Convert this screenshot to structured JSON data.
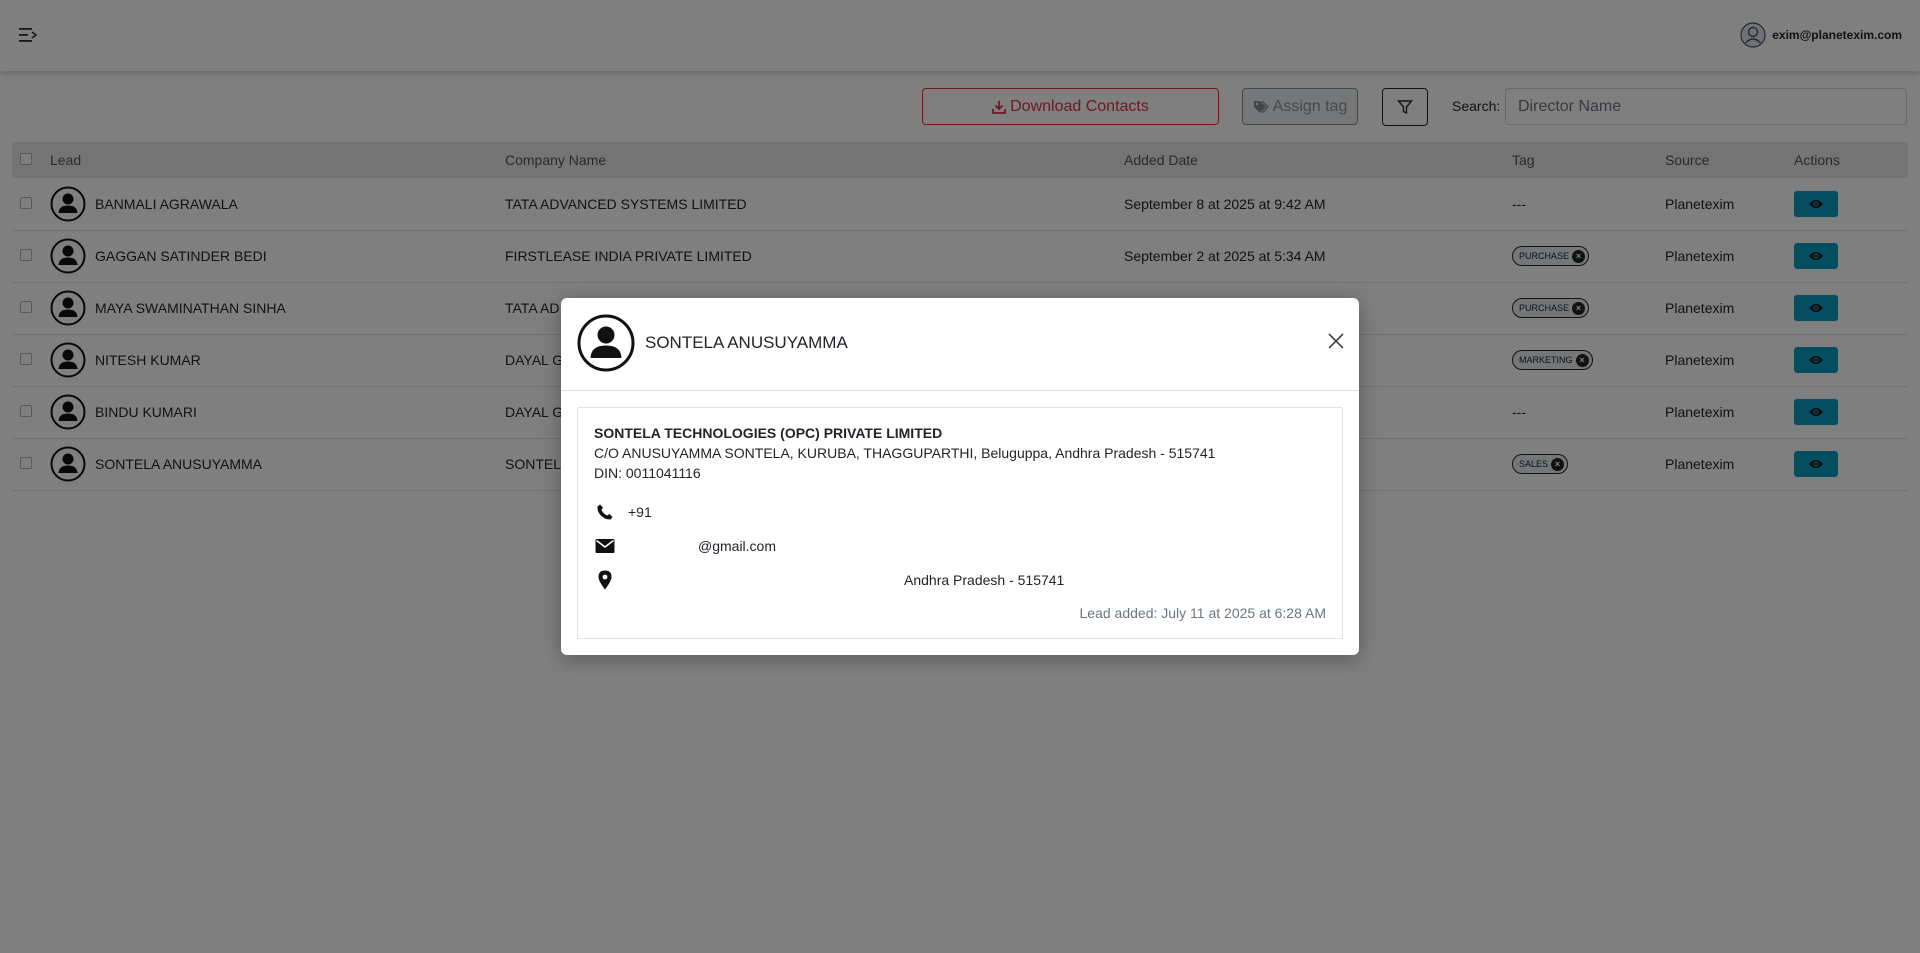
{
  "header": {
    "user_email": "exim@planetexim.com"
  },
  "toolbar": {
    "download_label": "Download Contacts",
    "assign_label": "Assign tag",
    "search_label": "Search:",
    "search_placeholder": "Director Name"
  },
  "table": {
    "columns": [
      "Lead",
      "Company Name",
      "Added Date",
      "Tag",
      "Source",
      "Actions"
    ],
    "rows": [
      {
        "lead": "BANMALI AGRAWALA",
        "company": "TATA ADVANCED SYSTEMS LIMITED",
        "date": "September 8 at 2025 at 9:42 AM",
        "tag": "---",
        "source": "Planetexim"
      },
      {
        "lead": "GAGGAN SATINDER BEDI",
        "company": "FIRSTLEASE INDIA PRIVATE LIMITED",
        "date": "September 2 at 2025 at 5:34 AM",
        "tag": "PURCHASE",
        "source": "Planetexim"
      },
      {
        "lead": "MAYA SWAMINATHAN SINHA",
        "company": "TATA AD",
        "date": "",
        "tag": "PURCHASE",
        "source": "Planetexim"
      },
      {
        "lead": "NITESH KUMAR",
        "company": "DAYAL G",
        "date": "",
        "tag": "MARKETING",
        "source": "Planetexim"
      },
      {
        "lead": "BINDU KUMARI",
        "company": "DAYAL G",
        "date": "",
        "tag": "---",
        "source": "Planetexim"
      },
      {
        "lead": "SONTELA ANUSUYAMMA",
        "company": "SONTEL",
        "date": "",
        "tag": "SALES",
        "source": "Planetexim"
      }
    ]
  },
  "modal": {
    "title": "SONTELA ANUSUYAMMA",
    "company": "SONTELA TECHNOLOGIES (OPC) PRIVATE LIMITED",
    "address": "C/O ANUSUYAMMA SONTELA, KURUBA, THAGGUPARTHI, Beluguppa, Andhra Pradesh - 515741",
    "din": "DIN: 0011041116",
    "phone": "+91",
    "email": "@gmail.com",
    "location": "Andhra Pradesh - 515741",
    "lead_added": "Lead added: July 11 at 2025 at 6:28 AM"
  },
  "colors": {
    "danger": "#dc3545",
    "info": "#0b9cc0"
  }
}
